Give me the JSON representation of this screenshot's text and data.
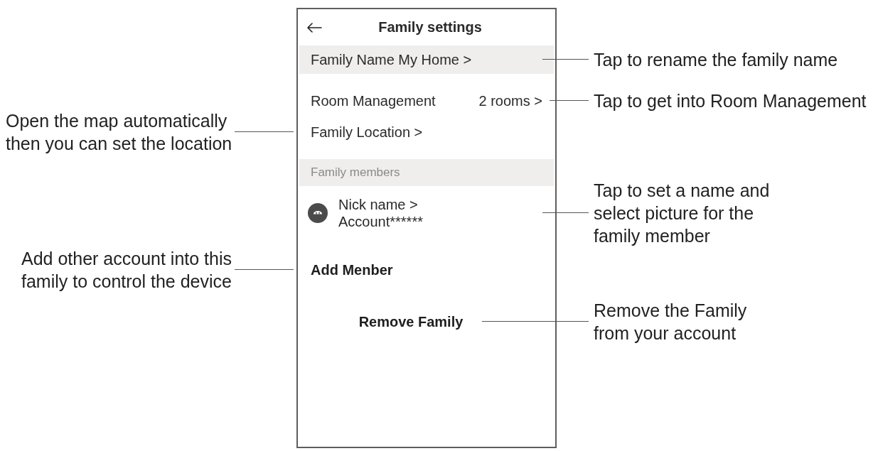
{
  "screen": {
    "title": "Family settings",
    "settings": [
      {
        "label": "Family Name My Home >",
        "highlighted": true,
        "callout": {
          "kind": "right",
          "text": "Tap to rename the family name"
        }
      },
      {
        "label": "Room Management",
        "value": "2 rooms >",
        "highlighted": false,
        "callout": {
          "kind": "right",
          "text": "Tap to get into Room Management"
        }
      },
      {
        "label": "Family Location >",
        "highlighted": false,
        "callout": {
          "kind": "left",
          "text": "Open the map automatically\nthen you can set the location"
        }
      }
    ],
    "members_section": {
      "title": "Family members",
      "members": [
        {
          "nickname": "Nick name >",
          "account": "Account******",
          "callout": {
            "kind": "right",
            "text": "Tap to set a name and\nselect picture for the\nfamily member"
          }
        }
      ]
    },
    "add_member": {
      "label": "Add Menber",
      "callout": {
        "kind": "left",
        "text": "Add other account into this\nfamily to control the device"
      }
    },
    "remove_family": {
      "label": "Remove Family",
      "callout": {
        "kind": "right",
        "text": "Remove the Family\nfrom your account"
      }
    }
  }
}
